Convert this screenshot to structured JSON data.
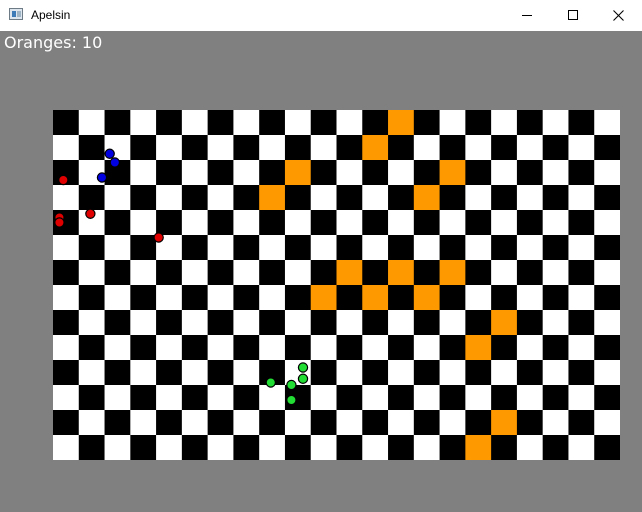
{
  "window": {
    "title": "Apelsin",
    "app_icon": "window-app-icon"
  },
  "controls": {
    "minimize_icon": "minimize-icon",
    "maximize_icon": "maximize-icon",
    "close_icon": "close-icon"
  },
  "hud": {
    "score_label": "Oranges: 10"
  },
  "colors": {
    "titlebar": "#ffffff",
    "client_background": "#808080",
    "light_square": "#ffffff",
    "dark_square": "#000000",
    "orange_square": "#ff9900",
    "red_piece": "#e00000",
    "blue_piece": "#0000e0",
    "green_piece": "#22dd33",
    "piece_outline": "#000000"
  },
  "board": {
    "columns": 22,
    "rows": 14,
    "orange_cells": [
      [
        13,
        0
      ],
      [
        12,
        1
      ],
      [
        9,
        2
      ],
      [
        15,
        2
      ],
      [
        8,
        3
      ],
      [
        14,
        3
      ],
      [
        11,
        6
      ],
      [
        13,
        6
      ],
      [
        15,
        6
      ],
      [
        10,
        7
      ],
      [
        12,
        7
      ],
      [
        14,
        7
      ],
      [
        17,
        8
      ],
      [
        16,
        9
      ],
      [
        17,
        12
      ],
      [
        16,
        13
      ]
    ]
  },
  "pieces": {
    "red": [
      {
        "col": 0.4,
        "row": 2.8
      },
      {
        "col": 1.45,
        "row": 4.15
      },
      {
        "col": 0.25,
        "row": 4.3
      },
      {
        "col": 0.25,
        "row": 4.5
      },
      {
        "col": 4.1,
        "row": 5.1
      }
    ],
    "blue": [
      {
        "col": 2.2,
        "row": 1.75
      },
      {
        "col": 2.4,
        "row": 2.1
      },
      {
        "col": 1.9,
        "row": 2.7
      }
    ],
    "green": [
      {
        "col": 8.45,
        "row": 10.9
      },
      {
        "col": 9.25,
        "row": 11.0
      },
      {
        "col": 9.7,
        "row": 10.75
      },
      {
        "col": 9.7,
        "row": 10.3
      },
      {
        "col": 9.25,
        "row": 11.6
      }
    ]
  }
}
